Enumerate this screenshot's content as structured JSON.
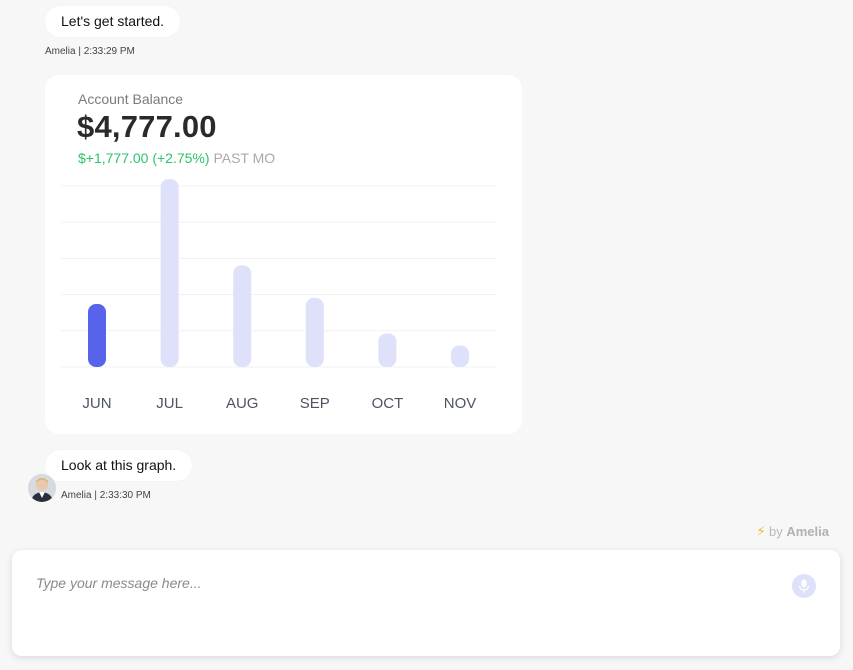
{
  "messages": [
    {
      "text": "Let's get started.",
      "sender": "Amelia",
      "time": "2:33:29 PM"
    },
    {
      "text": "Look at this graph.",
      "sender": "Amelia",
      "time": "2:33:30 PM"
    }
  ],
  "meta_separator": " | ",
  "card": {
    "title": "Account Balance",
    "amount": "$4,777.00",
    "change": "$+1,777.00 (+2.75%)",
    "period": "PAST MO"
  },
  "chart_data": {
    "type": "bar",
    "categories": [
      "JUN",
      "JUL",
      "AUG",
      "SEP",
      "OCT",
      "NOV"
    ],
    "values": [
      62,
      185,
      100,
      68,
      33,
      21
    ],
    "highlight_index": 0,
    "highlight_color": "#5763ea",
    "bar_color": "#dfe1fb",
    "ylim": [
      0,
      185
    ],
    "grid": true
  },
  "powered": {
    "prefix": "by",
    "brand": "Amelia"
  },
  "composer": {
    "placeholder": "Type your message here..."
  },
  "icons": {
    "avatar": "user-avatar",
    "mic": "microphone-icon",
    "bolt": "lightning-icon"
  }
}
